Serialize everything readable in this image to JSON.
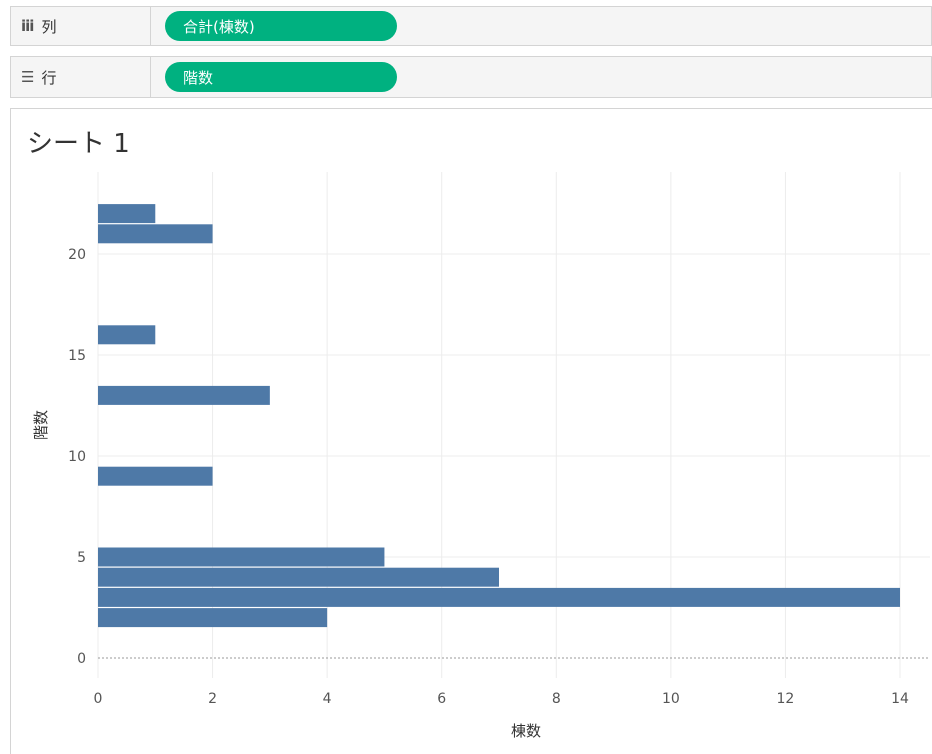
{
  "shelves": {
    "columns": {
      "icon": "iii",
      "label": "列",
      "pill": "合計(棟数)"
    },
    "rows": {
      "icon": "☰",
      "label": "行",
      "pill": "階数"
    }
  },
  "sheet": {
    "title": "シート 1"
  },
  "colors": {
    "bar": "#4e79a7",
    "pill": "#00b180",
    "grid": "#ececec"
  },
  "chart_data": {
    "type": "bar",
    "orientation": "horizontal",
    "xlabel": "棟数",
    "ylabel": "階数",
    "xlim": [
      0,
      14
    ],
    "ylim": [
      0,
      22
    ],
    "xticks": [
      0,
      2,
      4,
      6,
      8,
      10,
      12,
      14
    ],
    "yticks": [
      0,
      5,
      10,
      15,
      20
    ],
    "grid": true,
    "floors": [
      2,
      3,
      4,
      5,
      9,
      13,
      16,
      21,
      22
    ],
    "values": [
      4,
      14,
      7,
      5,
      2,
      3,
      1,
      2,
      1
    ]
  }
}
